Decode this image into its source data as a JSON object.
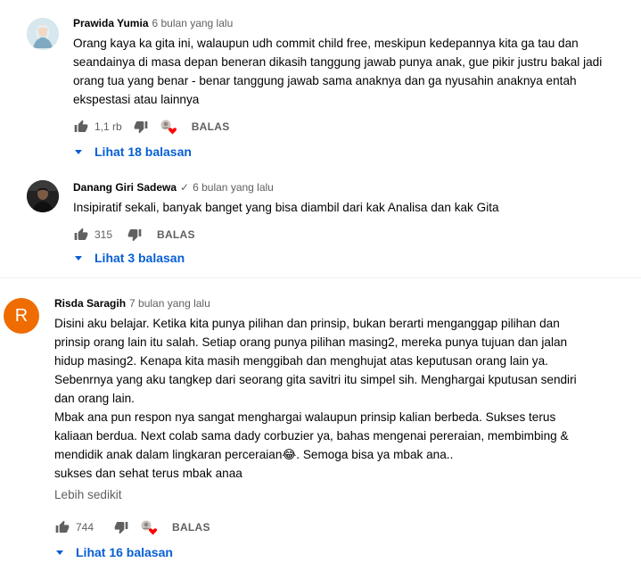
{
  "comments": [
    {
      "author": "Prawida Yumia",
      "verified": false,
      "time": "6 bulan yang lalu",
      "text": [
        "Orang kaya ka gita ini, walaupun udh commit child free, meskipun kedepannya kita ga tau dan",
        "seandainya di masa depan beneran dikasih tanggung jawab punya anak, gue pikir justru bakal jadi",
        "orang tua yang benar - benar tanggung jawab sama anaknya dan ga nyusahin anaknya entah",
        "ekspestasi atau lainnya"
      ],
      "likes": "1,1 rb",
      "creator_heart": true,
      "reply_label": "BALAS",
      "replies_label": "Lihat 18 balasan"
    },
    {
      "author": "Danang Giri Sadewa",
      "verified": true,
      "verified_mark": "✓",
      "time": "6 bulan yang lalu",
      "text": [
        "Insipiratif sekali, banyak banget yang bisa diambil dari kak Analisa dan kak Gita"
      ],
      "likes": "315",
      "creator_heart": false,
      "reply_label": "BALAS",
      "replies_label": "Lihat 3 balasan"
    },
    {
      "author": "Risda Saragih",
      "verified": false,
      "avatar_letter": "R",
      "avatar_color": "#ef6c00",
      "time": "7 bulan yang lalu",
      "text": [
        "Disini aku belajar. Ketika kita punya pilihan dan prinsip, bukan berarti menganggap pilihan dan",
        "prinsip orang lain itu salah. Setiap orang punya pilihan masing2, mereka punya tujuan dan jalan",
        "hidup masing2. Kenapa kita masih menggibah dan menghujat atas keputusan orang lain ya.",
        "Sebenrnya yang aku tangkep dari seorang gita savitri itu simpel sih. Menghargai kputusan sendiri",
        "dan orang lain.",
        "Mbak ana pun respon nya sangat menghargai walaupun prinsip kalian berbeda. Sukses terus",
        "kaliaan berdua. Next colab sama dady corbuzier ya, bahas mengenai pereraian, membimbing &",
        "mendidik anak dalam lingkaran perceraian😂. Semoga bisa ya mbak ana..",
        "sukses dan sehat terus mbak anaa"
      ],
      "less_label": "Lebih sedikit",
      "likes": "744",
      "creator_heart": true,
      "reply_label": "BALAS",
      "replies_label": "Lihat 16 balasan"
    }
  ],
  "colors": {
    "link_blue": "#065fd4",
    "secondary_text": "#606060",
    "heart_red": "#ff0000"
  },
  "icons": [
    "thumbs-up-icon",
    "thumbs-down-icon",
    "creator-heart-icon",
    "caret-down-icon",
    "verified-check-icon"
  ]
}
